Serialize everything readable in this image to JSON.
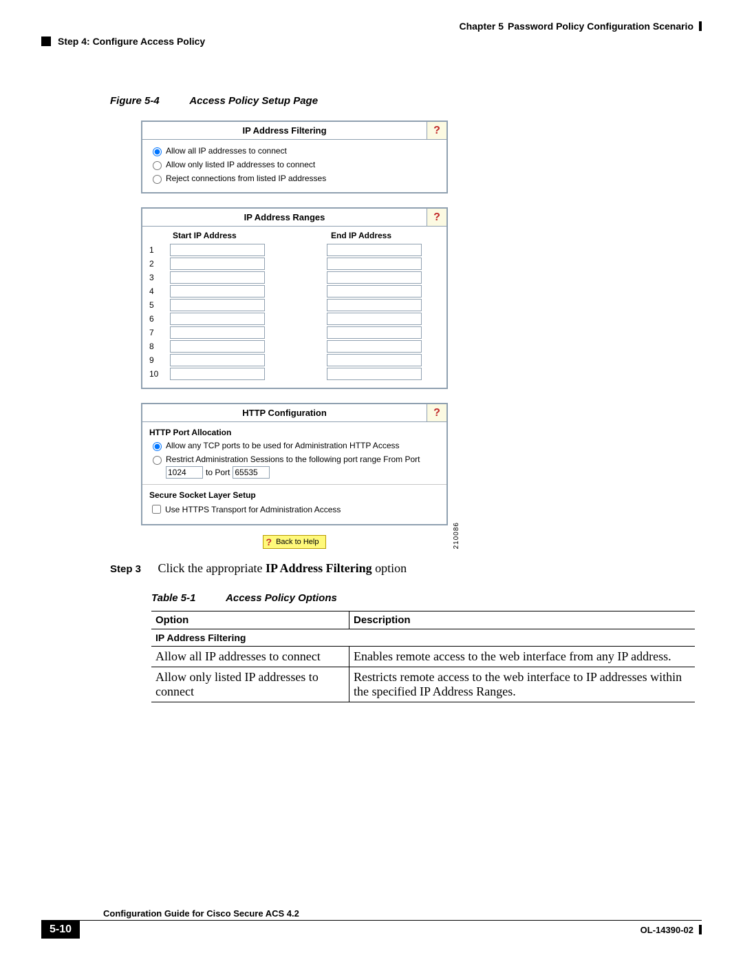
{
  "header": {
    "chapter_label": "Chapter 5",
    "chapter_title": "Password Policy Configuration Scenario",
    "section_title": "Step 4: Configure Access Policy"
  },
  "figure": {
    "label": "Figure 5-4",
    "title": "Access Policy Setup Page"
  },
  "panels": {
    "ip_filter": {
      "title": "IP Address Filtering",
      "options": [
        "Allow all IP addresses to connect",
        "Allow only listed IP addresses to connect",
        "Reject connections from listed IP addresses"
      ],
      "selected_index": 0
    },
    "ip_ranges": {
      "title": "IP Address Ranges",
      "col_start": "Start IP Address",
      "col_end": "End IP Address",
      "row_labels": [
        "1",
        "2",
        "3",
        "4",
        "5",
        "6",
        "7",
        "8",
        "9",
        "10"
      ]
    },
    "http": {
      "title": "HTTP Configuration",
      "alloc_heading": "HTTP Port Allocation",
      "opt_any": "Allow any TCP ports to be used for Administration HTTP Access",
      "opt_restrict": "Restrict Administration Sessions to the following port range From Port",
      "from_port": "1024",
      "to_label": "to Port",
      "to_port": "65535",
      "ssl_heading": "Secure Socket Layer Setup",
      "ssl_checkbox": "Use HTTPS Transport for Administration Access",
      "selected_index": 0
    },
    "back_help": "Back to Help",
    "side_id": "210086"
  },
  "step3": {
    "label": "Step 3",
    "pre": "Click the appropriate ",
    "bold": "IP Address Filtering",
    "post": " option"
  },
  "table": {
    "label": "Table 5-1",
    "title": "Access Policy Options",
    "head_option": "Option",
    "head_desc": "Description",
    "section": "IP Address Filtering",
    "rows": [
      {
        "opt": "Allow all IP addresses to connect",
        "desc": "Enables remote access to the web interface from any IP address."
      },
      {
        "opt": "Allow only listed IP addresses to connect",
        "desc": "Restricts remote access to the web interface to IP addresses within the specified IP Address Ranges."
      }
    ]
  },
  "footer": {
    "guide": "Configuration Guide for Cisco Secure ACS 4.2",
    "page": "5-10",
    "docid": "OL-14390-02"
  }
}
